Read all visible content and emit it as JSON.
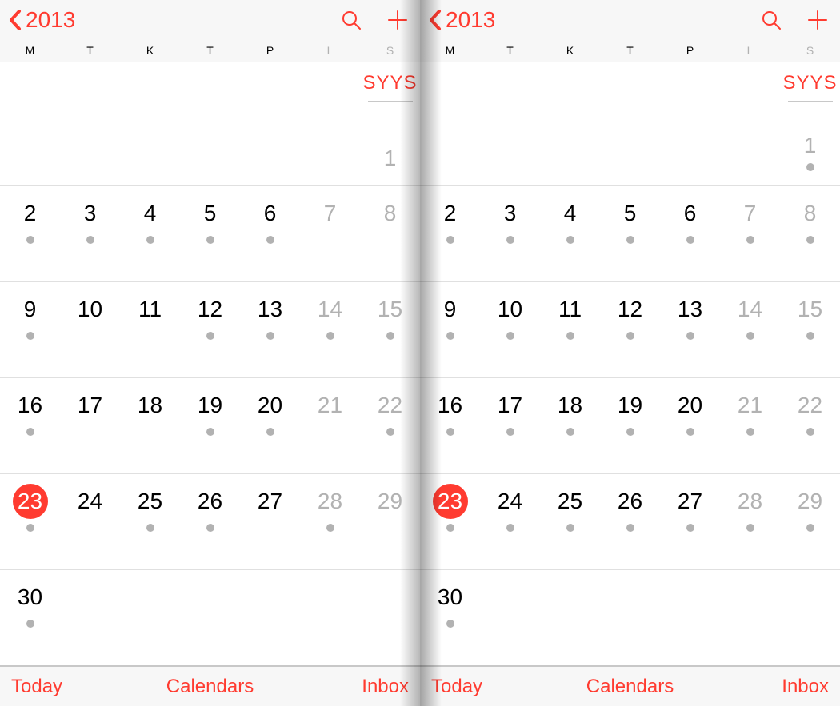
{
  "header": {
    "back_label": "2013",
    "month_abbrev": "SYYS"
  },
  "days": [
    "M",
    "T",
    "K",
    "T",
    "P",
    "L",
    "S"
  ],
  "bottom": {
    "today": "Today",
    "calendars": "Calendars",
    "inbox": "Inbox"
  },
  "colors": {
    "accent": "#ff3b30"
  },
  "panels": [
    {
      "id": "left",
      "first_day": {
        "value": "1",
        "has_dot": false
      },
      "weeks": [
        [
          {
            "n": "2",
            "weekend": false,
            "today": false,
            "dot": true
          },
          {
            "n": "3",
            "weekend": false,
            "today": false,
            "dot": true
          },
          {
            "n": "4",
            "weekend": false,
            "today": false,
            "dot": true
          },
          {
            "n": "5",
            "weekend": false,
            "today": false,
            "dot": true
          },
          {
            "n": "6",
            "weekend": false,
            "today": false,
            "dot": true
          },
          {
            "n": "7",
            "weekend": true,
            "today": false,
            "dot": false
          },
          {
            "n": "8",
            "weekend": true,
            "today": false,
            "dot": false
          }
        ],
        [
          {
            "n": "9",
            "weekend": false,
            "today": false,
            "dot": true
          },
          {
            "n": "10",
            "weekend": false,
            "today": false,
            "dot": false
          },
          {
            "n": "11",
            "weekend": false,
            "today": false,
            "dot": false
          },
          {
            "n": "12",
            "weekend": false,
            "today": false,
            "dot": true
          },
          {
            "n": "13",
            "weekend": false,
            "today": false,
            "dot": true
          },
          {
            "n": "14",
            "weekend": true,
            "today": false,
            "dot": true
          },
          {
            "n": "15",
            "weekend": true,
            "today": false,
            "dot": true
          }
        ],
        [
          {
            "n": "16",
            "weekend": false,
            "today": false,
            "dot": true
          },
          {
            "n": "17",
            "weekend": false,
            "today": false,
            "dot": false
          },
          {
            "n": "18",
            "weekend": false,
            "today": false,
            "dot": false
          },
          {
            "n": "19",
            "weekend": false,
            "today": false,
            "dot": true
          },
          {
            "n": "20",
            "weekend": false,
            "today": false,
            "dot": true
          },
          {
            "n": "21",
            "weekend": true,
            "today": false,
            "dot": false
          },
          {
            "n": "22",
            "weekend": true,
            "today": false,
            "dot": true
          }
        ],
        [
          {
            "n": "23",
            "weekend": false,
            "today": true,
            "dot": true
          },
          {
            "n": "24",
            "weekend": false,
            "today": false,
            "dot": false
          },
          {
            "n": "25",
            "weekend": false,
            "today": false,
            "dot": true
          },
          {
            "n": "26",
            "weekend": false,
            "today": false,
            "dot": true
          },
          {
            "n": "27",
            "weekend": false,
            "today": false,
            "dot": false
          },
          {
            "n": "28",
            "weekend": true,
            "today": false,
            "dot": true
          },
          {
            "n": "29",
            "weekend": true,
            "today": false,
            "dot": false
          }
        ],
        [
          {
            "n": "30",
            "weekend": false,
            "today": false,
            "dot": true
          },
          {
            "n": "",
            "weekend": false,
            "today": false,
            "dot": false
          },
          {
            "n": "",
            "weekend": false,
            "today": false,
            "dot": false
          },
          {
            "n": "",
            "weekend": false,
            "today": false,
            "dot": false
          },
          {
            "n": "",
            "weekend": false,
            "today": false,
            "dot": false
          },
          {
            "n": "",
            "weekend": true,
            "today": false,
            "dot": false
          },
          {
            "n": "",
            "weekend": true,
            "today": false,
            "dot": false
          }
        ]
      ]
    },
    {
      "id": "right",
      "first_day": {
        "value": "1",
        "has_dot": true
      },
      "weeks": [
        [
          {
            "n": "2",
            "weekend": false,
            "today": false,
            "dot": true
          },
          {
            "n": "3",
            "weekend": false,
            "today": false,
            "dot": true
          },
          {
            "n": "4",
            "weekend": false,
            "today": false,
            "dot": true
          },
          {
            "n": "5",
            "weekend": false,
            "today": false,
            "dot": true
          },
          {
            "n": "6",
            "weekend": false,
            "today": false,
            "dot": true
          },
          {
            "n": "7",
            "weekend": true,
            "today": false,
            "dot": true
          },
          {
            "n": "8",
            "weekend": true,
            "today": false,
            "dot": true
          }
        ],
        [
          {
            "n": "9",
            "weekend": false,
            "today": false,
            "dot": true
          },
          {
            "n": "10",
            "weekend": false,
            "today": false,
            "dot": true
          },
          {
            "n": "11",
            "weekend": false,
            "today": false,
            "dot": true
          },
          {
            "n": "12",
            "weekend": false,
            "today": false,
            "dot": true
          },
          {
            "n": "13",
            "weekend": false,
            "today": false,
            "dot": true
          },
          {
            "n": "14",
            "weekend": true,
            "today": false,
            "dot": true
          },
          {
            "n": "15",
            "weekend": true,
            "today": false,
            "dot": true
          }
        ],
        [
          {
            "n": "16",
            "weekend": false,
            "today": false,
            "dot": true
          },
          {
            "n": "17",
            "weekend": false,
            "today": false,
            "dot": true
          },
          {
            "n": "18",
            "weekend": false,
            "today": false,
            "dot": true
          },
          {
            "n": "19",
            "weekend": false,
            "today": false,
            "dot": true
          },
          {
            "n": "20",
            "weekend": false,
            "today": false,
            "dot": true
          },
          {
            "n": "21",
            "weekend": true,
            "today": false,
            "dot": true
          },
          {
            "n": "22",
            "weekend": true,
            "today": false,
            "dot": true
          }
        ],
        [
          {
            "n": "23",
            "weekend": false,
            "today": true,
            "dot": true
          },
          {
            "n": "24",
            "weekend": false,
            "today": false,
            "dot": true
          },
          {
            "n": "25",
            "weekend": false,
            "today": false,
            "dot": true
          },
          {
            "n": "26",
            "weekend": false,
            "today": false,
            "dot": true
          },
          {
            "n": "27",
            "weekend": false,
            "today": false,
            "dot": true
          },
          {
            "n": "28",
            "weekend": true,
            "today": false,
            "dot": true
          },
          {
            "n": "29",
            "weekend": true,
            "today": false,
            "dot": true
          }
        ],
        [
          {
            "n": "30",
            "weekend": false,
            "today": false,
            "dot": true
          },
          {
            "n": "",
            "weekend": false,
            "today": false,
            "dot": false
          },
          {
            "n": "",
            "weekend": false,
            "today": false,
            "dot": false
          },
          {
            "n": "",
            "weekend": false,
            "today": false,
            "dot": false
          },
          {
            "n": "",
            "weekend": false,
            "today": false,
            "dot": false
          },
          {
            "n": "",
            "weekend": true,
            "today": false,
            "dot": false
          },
          {
            "n": "",
            "weekend": true,
            "today": false,
            "dot": false
          }
        ]
      ]
    }
  ]
}
